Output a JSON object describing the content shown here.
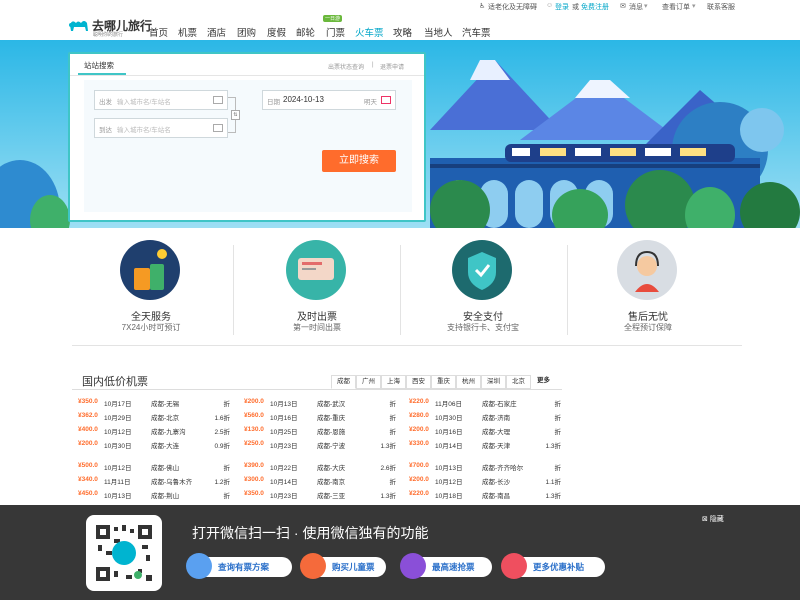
{
  "util": {
    "accessibility": "适老化及无障碍",
    "login": "登录",
    "or": "或",
    "register": "免费注册",
    "messages": "消息",
    "orders": "查看订单",
    "service": "联系客服"
  },
  "logo": {
    "name": "去哪儿旅行",
    "slogan": "聪明你的旅行"
  },
  "nav": {
    "items": [
      "首页",
      "机票",
      "酒店",
      "团购",
      "度假",
      "邮轮",
      "门票",
      "火车票",
      "攻略",
      "当地人",
      "汽车票"
    ],
    "ticket_tag": "一日游",
    "active": "火车票"
  },
  "search": {
    "tab": "站站搜索",
    "link1": "出票状态查询",
    "sep": "|",
    "link2": "退票申请",
    "from_label": "出发",
    "from_placeholder": "输入城市名/车站名",
    "to_label": "到达",
    "to_placeholder": "输入城市名/车站名",
    "swap": "⇅",
    "date_label": "日期",
    "date_value": "2024-10-13",
    "weekday": "明天",
    "button": "立即搜索"
  },
  "services": [
    {
      "title": "全天服务",
      "desc": "7X24小时可预订"
    },
    {
      "title": "及时出票",
      "desc": "第一时间出票"
    },
    {
      "title": "安全支付",
      "desc": "支持银行卡、支付宝"
    },
    {
      "title": "售后无忧",
      "desc": "全程预订保障"
    }
  ],
  "lowfare": {
    "title": "国内低价机票",
    "cities": [
      "成都",
      "广州",
      "上海",
      "西安",
      "重庆",
      "杭州",
      "深圳",
      "北京"
    ],
    "more": "更多",
    "col1": [
      [
        "¥350.0",
        "10月17日",
        "成都-无锡",
        "折"
      ],
      [
        "¥362.0",
        "10月29日",
        "成都-北京",
        "1.6折"
      ],
      [
        "¥400.0",
        "10月12日",
        "成都-九寨沟",
        "2.5折"
      ],
      [
        "¥200.0",
        "10月30日",
        "成都-大连",
        "0.9折"
      ],
      [
        "¥500.0",
        "10月12日",
        "成都-佛山",
        "折"
      ],
      [
        "¥340.0",
        "11月11日",
        "成都-乌鲁木齐",
        "1.2折"
      ],
      [
        "¥450.0",
        "10月13日",
        "成都-荆山",
        "折"
      ]
    ],
    "col2": [
      [
        "¥200.0",
        "10月13日",
        "成都-武汉",
        "折"
      ],
      [
        "¥560.0",
        "10月16日",
        "成都-重庆",
        "折"
      ],
      [
        "¥130.0",
        "10月25日",
        "成都-恩施",
        "折"
      ],
      [
        "¥250.0",
        "10月23日",
        "成都-宁波",
        "1.3折"
      ],
      [
        "¥390.0",
        "10月22日",
        "成都-大庆",
        "2.6折"
      ],
      [
        "¥300.0",
        "10月14日",
        "成都-南京",
        "折"
      ],
      [
        "¥350.0",
        "10月23日",
        "成都-三亚",
        "1.3折"
      ]
    ],
    "col3": [
      [
        "¥220.0",
        "11月06日",
        "成都-石家庄",
        "折"
      ],
      [
        "¥280.0",
        "10月30日",
        "成都-济南",
        "折"
      ],
      [
        "¥200.0",
        "10月16日",
        "成都-大理",
        "折"
      ],
      [
        "¥330.0",
        "10月14日",
        "成都-天津",
        "1.3折"
      ],
      [
        "¥700.0",
        "10月13日",
        "成都-齐齐哈尔",
        "折"
      ],
      [
        "¥200.0",
        "10月12日",
        "成都-长沙",
        "1.1折"
      ],
      [
        "¥220.0",
        "10月18日",
        "成都-南昌",
        "1.3折"
      ]
    ]
  },
  "promo": {
    "title": "打开微信扫一扫 · 使用微信独有的功能",
    "close": "隐藏",
    "buttons": [
      "查询有票方案",
      "购买儿童票",
      "最高速抢票",
      "更多优惠补贴"
    ]
  }
}
